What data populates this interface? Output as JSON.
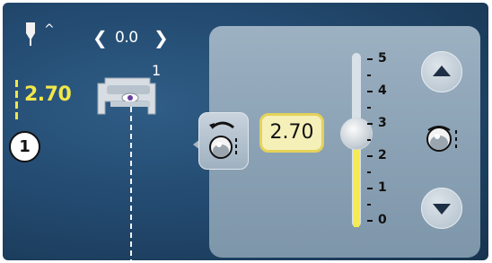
{
  "header": {
    "needle_symbol": "^",
    "offset_left_arrow": "❮",
    "offset_value": "0.0",
    "offset_right_arrow": "❯"
  },
  "indicator": {
    "current_value": "2.70",
    "badge": "1",
    "foot_number": "1"
  },
  "panel": {
    "value_display": "2.70",
    "scale_labels": [
      "5",
      "4",
      "3",
      "2",
      "1",
      "0"
    ],
    "slider_level": 2.7,
    "up_label": "up",
    "down_label": "down"
  },
  "colors": {
    "screen_bg": "#234a70",
    "panel_bg": "#8aa1b4",
    "value_text": "#f2e64a",
    "slider_fill": "#f4ea52"
  },
  "icons": [
    "needle-icon",
    "presser-foot-icon",
    "reset-arrow-icon",
    "knob-icon",
    "up-arrow-icon",
    "down-arrow-icon"
  ]
}
